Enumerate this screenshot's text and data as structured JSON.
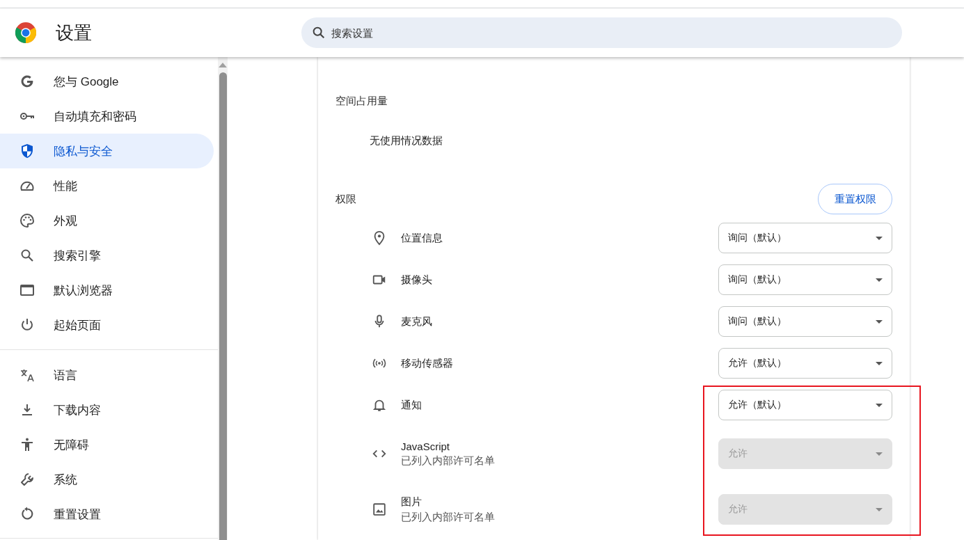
{
  "header": {
    "title": "设置",
    "search": {
      "placeholder": "搜索设置"
    }
  },
  "sidebar": {
    "groups": [
      {
        "items": [
          {
            "label": "您与 Google",
            "selected": false
          },
          {
            "label": "自动填充和密码",
            "selected": false
          },
          {
            "label": "隐私与安全",
            "selected": true
          },
          {
            "label": "性能",
            "selected": false
          },
          {
            "label": "外观",
            "selected": false
          },
          {
            "label": "搜索引擎",
            "selected": false
          },
          {
            "label": "默认浏览器",
            "selected": false
          },
          {
            "label": "起始页面",
            "selected": false
          }
        ]
      },
      {
        "items": [
          {
            "label": "语言",
            "selected": false
          },
          {
            "label": "下载内容",
            "selected": false
          },
          {
            "label": "无障碍",
            "selected": false
          },
          {
            "label": "系统",
            "selected": false
          },
          {
            "label": "重置设置",
            "selected": false
          }
        ]
      }
    ]
  },
  "site": {
    "storage": {
      "heading": "空间占用量",
      "value": "无使用情况数据"
    },
    "permissions": {
      "heading": "权限",
      "reset_button": "重置权限",
      "items": [
        {
          "label": "位置信息",
          "value": "询问（默认）",
          "disabled": false
        },
        {
          "label": "摄像头",
          "value": "询问（默认）",
          "disabled": false
        },
        {
          "label": "麦克风",
          "value": "询问（默认）",
          "disabled": false
        },
        {
          "label": "移动传感器",
          "value": "允许（默认）",
          "disabled": false
        },
        {
          "label": "通知",
          "value": "允许（默认）",
          "disabled": false
        },
        {
          "label": "JavaScript",
          "note": "已列入内部许可名单",
          "value": "允许",
          "disabled": true
        },
        {
          "label": "图片",
          "note": "已列入内部许可名单",
          "value": "允许",
          "disabled": true
        }
      ]
    }
  }
}
